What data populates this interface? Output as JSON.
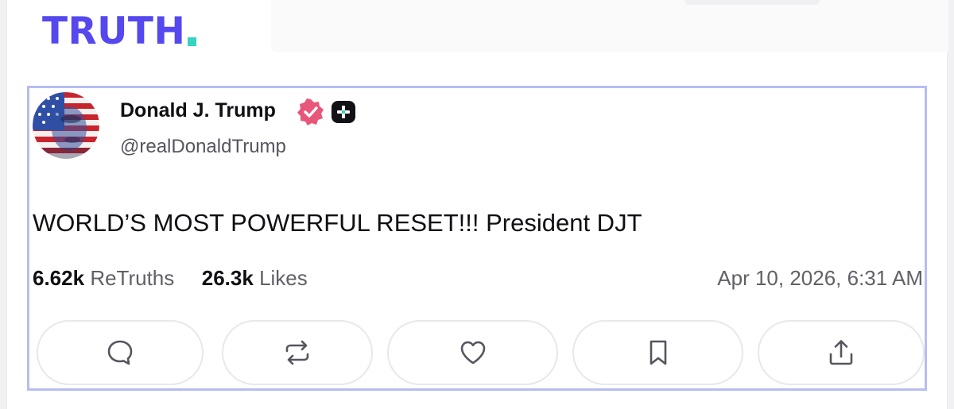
{
  "brand": {
    "logo_text": "TRUTH",
    "primary_color": "#5448ee",
    "dot_color": "#34d4c0"
  },
  "post": {
    "author": {
      "display_name": "Donald J. Trump",
      "handle": "@realDonaldTrump",
      "verified_icon": "verified-badge-icon",
      "verified_color": "#e8567a",
      "extra_badge_icon": "plus-badge-icon"
    },
    "text": "WORLD’S MOST POWERFUL RESET!!! President DJT",
    "stats": {
      "retruths_count": "6.62k",
      "retruths_label": "ReTruths",
      "likes_count": "26.3k",
      "likes_label": "Likes"
    },
    "timestamp": "Apr 10, 2026, 6:31 AM",
    "actions": [
      {
        "name": "reply",
        "icon": "comment-icon"
      },
      {
        "name": "retruth",
        "icon": "repost-icon"
      },
      {
        "name": "like",
        "icon": "heart-icon"
      },
      {
        "name": "bookmark",
        "icon": "bookmark-icon"
      },
      {
        "name": "share",
        "icon": "share-icon"
      }
    ],
    "card_border_color": "#b7bdf2"
  }
}
